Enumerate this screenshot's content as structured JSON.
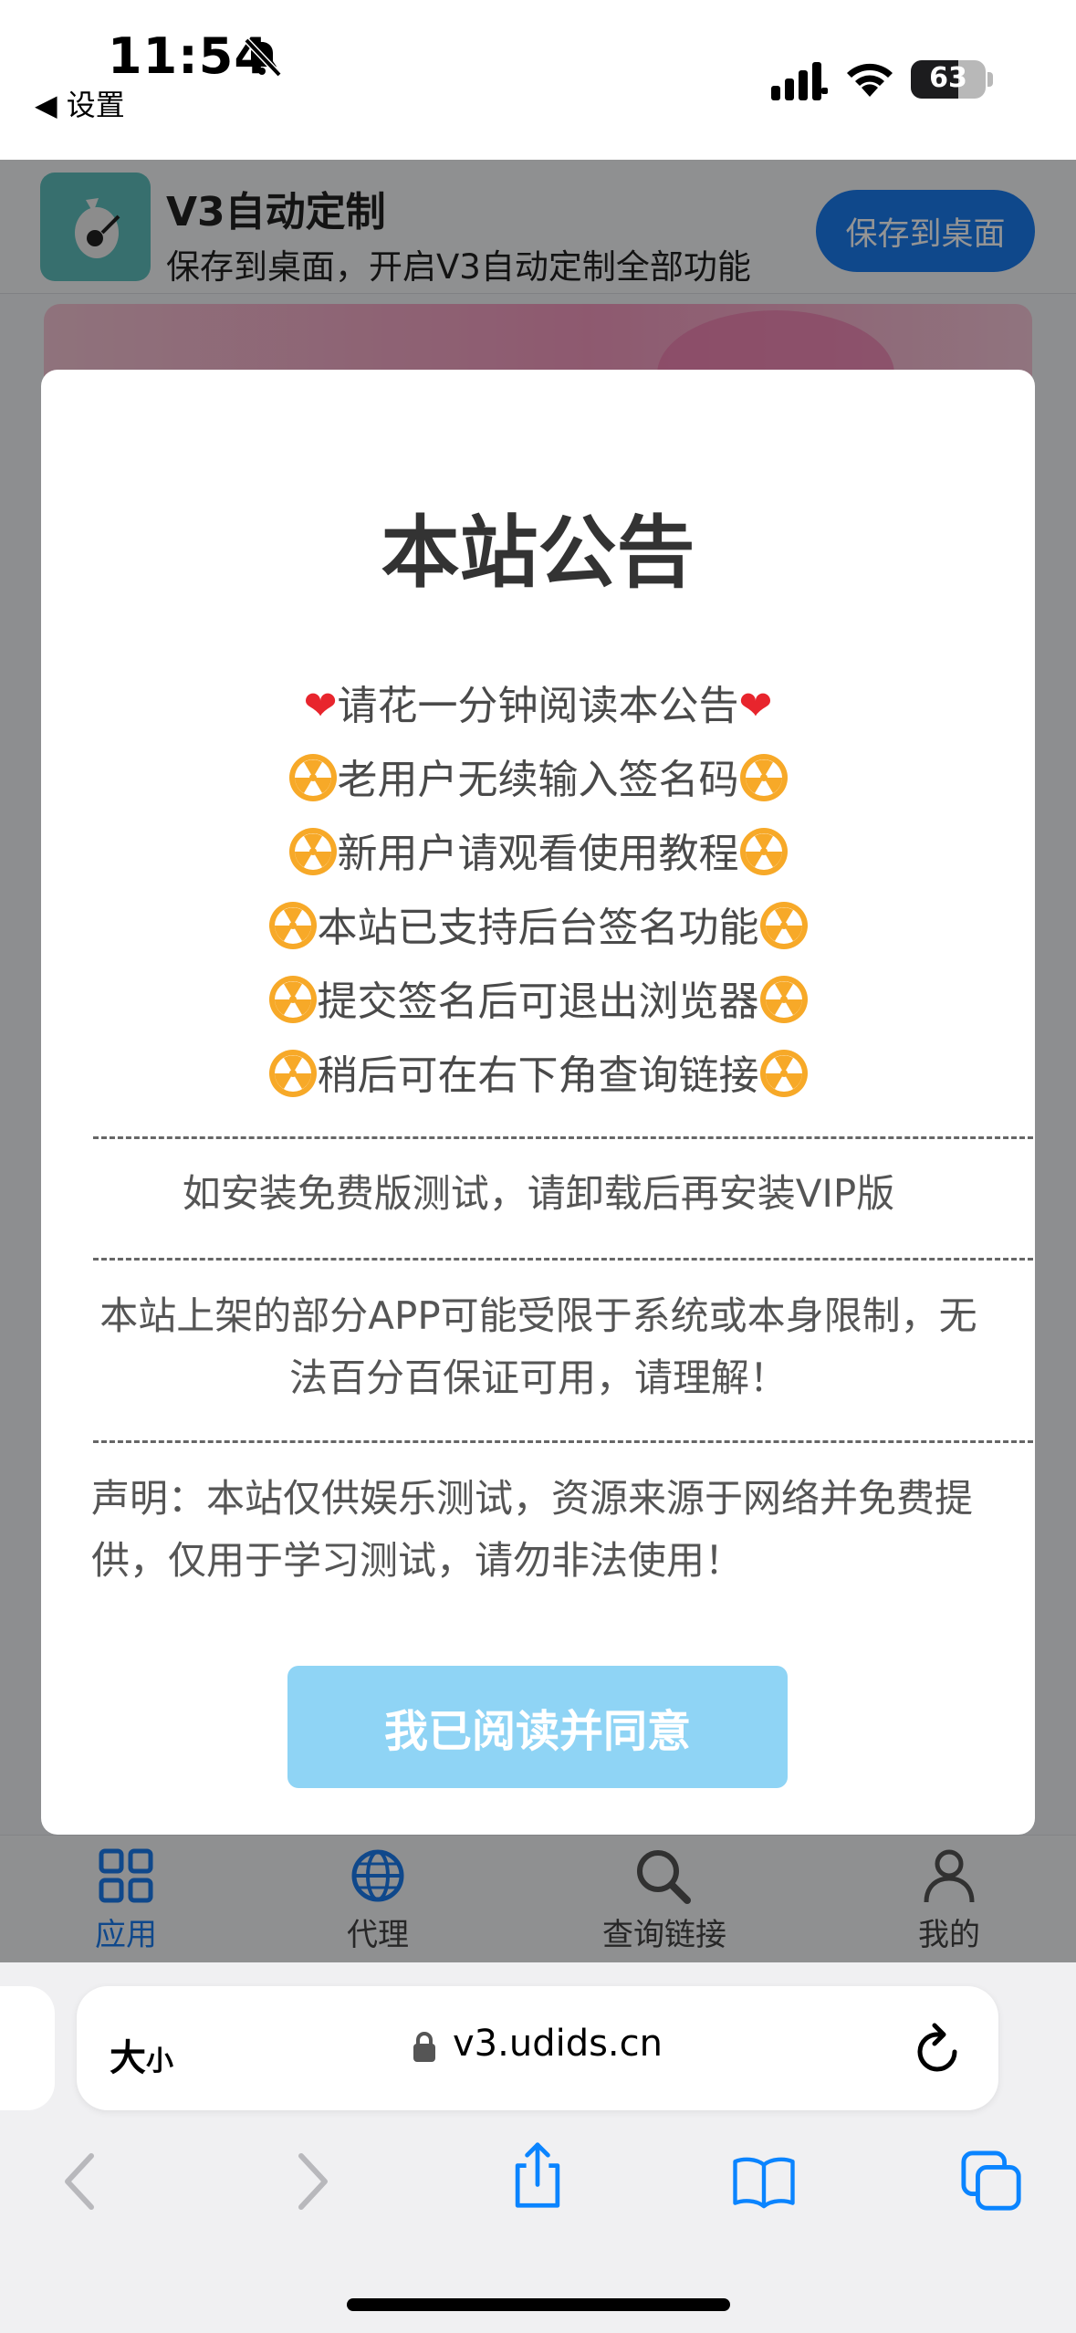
{
  "status_bar": {
    "time": "11:54",
    "back_app": "◀ 设置",
    "battery": "63"
  },
  "banner": {
    "app_name": "V3自动定制",
    "subtitle": "保存到桌面，开启V3自动定制全部功能",
    "save_button": "保存到桌面"
  },
  "modal": {
    "title": "本站公告",
    "lines": [
      "请花一分钟阅读本公告",
      "老用户无续输入签名码",
      "新用户请观看使用教程",
      "本站已支持后台签名功能",
      "提交签名后可退出浏览器",
      "稍后可在右下角查询链接"
    ],
    "paragraph_1": "如安装免费版测试，请卸载后再安装VIP版",
    "paragraph_2": "本站上架的部分APP可能受限于系统或本身限制，无法百分百保证可用，请理解！",
    "paragraph_3": "声明：本站仅供娱乐测试，资源来源于网络并免费提供，仅用于学习测试，请勿非法使用！",
    "agree_button": "我已阅读并同意"
  },
  "tabbar": {
    "tabs": [
      {
        "label": "应用",
        "icon": "grid-icon",
        "active": true
      },
      {
        "label": "代理",
        "icon": "globe-icon",
        "active": false
      },
      {
        "label": "查询链接",
        "icon": "search-icon",
        "active": false
      },
      {
        "label": "我的",
        "icon": "person-icon",
        "active": false
      }
    ]
  },
  "safari": {
    "text_size_big": "大",
    "text_size_small": "小",
    "url": "v3.udids.cn"
  },
  "colors": {
    "accent": "#1a7cf0",
    "agree_button": "#8fd4f5",
    "safari_blue": "#0a84ff"
  }
}
